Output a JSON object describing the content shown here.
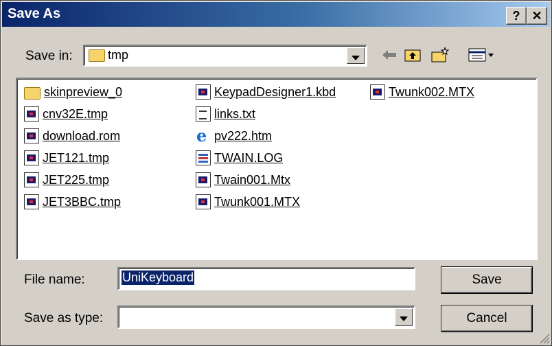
{
  "window": {
    "title": "Save As",
    "help_label": "?",
    "close_label": "✕"
  },
  "save_in": {
    "label": "Save in:",
    "value": "tmp"
  },
  "files": [
    {
      "name": "skinpreview_0",
      "icon": "folder-icon"
    },
    {
      "name": "cnv32E.tmp",
      "icon": "file-icon"
    },
    {
      "name": "download.rom",
      "icon": "file-icon"
    },
    {
      "name": "JET121.tmp",
      "icon": "file-icon"
    },
    {
      "name": "JET225.tmp",
      "icon": "file-icon"
    },
    {
      "name": "JET3BBC.tmp",
      "icon": "file-icon"
    },
    {
      "name": "KeypadDesigner1.kbd",
      "icon": "file-icon"
    },
    {
      "name": "links.txt",
      "icon": "text-file-icon"
    },
    {
      "name": "pv222.htm",
      "icon": "ie-document-icon"
    },
    {
      "name": "TWAIN.LOG",
      "icon": "log-file-icon"
    },
    {
      "name": "Twain001.Mtx",
      "icon": "file-icon"
    },
    {
      "name": "Twunk001.MTX",
      "icon": "file-icon"
    },
    {
      "name": "Twunk002.MTX",
      "icon": "file-icon"
    }
  ],
  "file_name": {
    "label": "File name:",
    "value": "UniKeyboard"
  },
  "save_as_type": {
    "label": "Save as type:",
    "value": ""
  },
  "buttons": {
    "save": "Save",
    "cancel": "Cancel"
  }
}
